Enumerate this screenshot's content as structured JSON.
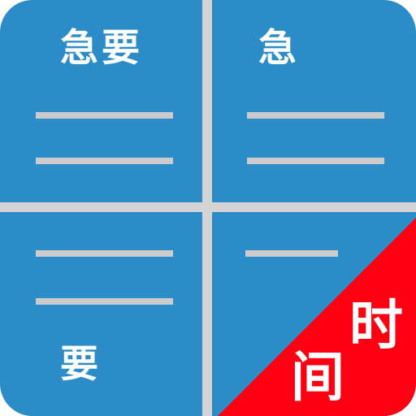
{
  "colors": {
    "quadrant": "#2b8cc8",
    "divider": "#d4d4d4",
    "line": "#cccccc",
    "corner": "#ff0012",
    "text": "#ffffff"
  },
  "quadrants": {
    "top_left": {
      "label": "急要"
    },
    "top_right": {
      "label": "急"
    },
    "bottom_left": {
      "label": "要"
    }
  },
  "corner_banner": {
    "line1": "时",
    "line2": "间"
  }
}
